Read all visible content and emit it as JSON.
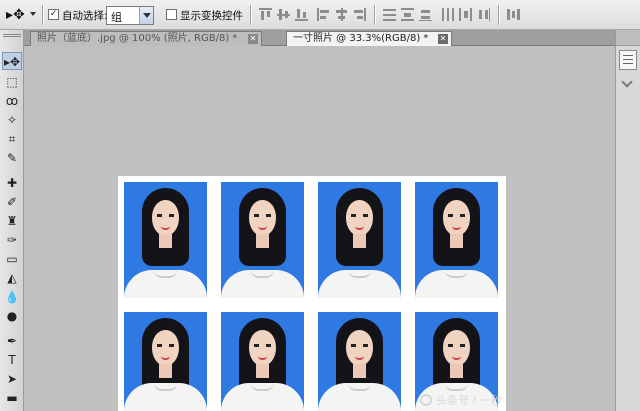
{
  "options_bar": {
    "tool_icon": "move-tool-icon",
    "auto_select_checked": "✓",
    "auto_select_label": "自动选择:",
    "auto_select_target": "组",
    "show_transform_label": "显示变换控件"
  },
  "tabs": [
    {
      "label": "照片（蓝底）.jpg @ 100% (照片, RGB/8) *",
      "close": "✕"
    },
    {
      "label": "一寸照片 @ 33.3%(RGB/8) *",
      "close": "✕"
    }
  ],
  "toolbox": {
    "tools": [
      {
        "name": "move-tool",
        "glyph": "▸✥"
      },
      {
        "name": "marquee-tool",
        "glyph": "⬚"
      },
      {
        "name": "lasso-tool",
        "glyph": "ꝏ"
      },
      {
        "name": "quick-select-tool",
        "glyph": "✧"
      },
      {
        "name": "crop-tool",
        "glyph": "⌗"
      },
      {
        "name": "eyedropper-tool",
        "glyph": "✎"
      },
      {
        "name": "healing-tool",
        "glyph": "✚"
      },
      {
        "name": "brush-tool",
        "glyph": "✐"
      },
      {
        "name": "stamp-tool",
        "glyph": "♜"
      },
      {
        "name": "history-brush-tool",
        "glyph": "✑"
      },
      {
        "name": "eraser-tool",
        "glyph": "▭"
      },
      {
        "name": "paint-bucket-tool",
        "glyph": "◭"
      },
      {
        "name": "blur-tool",
        "glyph": "💧"
      },
      {
        "name": "dodge-tool",
        "glyph": "●"
      },
      {
        "name": "pen-tool",
        "glyph": "✒"
      },
      {
        "name": "type-tool",
        "glyph": "T"
      },
      {
        "name": "path-select-tool",
        "glyph": "➤"
      },
      {
        "name": "shape-tool",
        "glyph": "▬"
      }
    ]
  },
  "watermark": "头条号 / 一秒"
}
